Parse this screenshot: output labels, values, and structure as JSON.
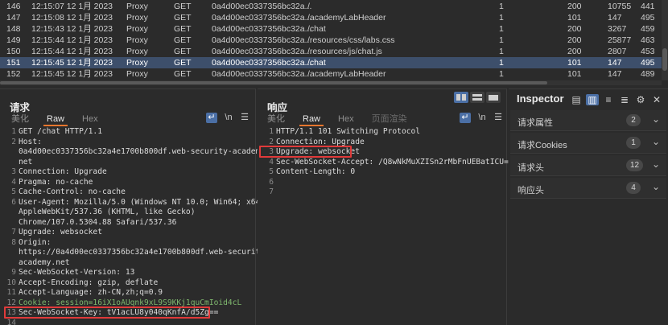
{
  "history": {
    "rows": [
      {
        "num": "146",
        "time": "12:15:07 12 1月 2023",
        "tool": "Proxy",
        "method": "GET",
        "host": "0a4d00ec0337356bc32a...",
        "path": "/",
        "flag": "1",
        "status": "200",
        "length": "10755",
        "extra": "441",
        "selected": false
      },
      {
        "num": "147",
        "time": "12:15:08 12 1月 2023",
        "tool": "Proxy",
        "method": "GET",
        "host": "0a4d00ec0337356bc32a...",
        "path": "/academyLabHeader",
        "flag": "1",
        "status": "101",
        "length": "147",
        "extra": "495",
        "selected": false
      },
      {
        "num": "148",
        "time": "12:15:43 12 1月 2023",
        "tool": "Proxy",
        "method": "GET",
        "host": "0a4d00ec0337356bc32a...",
        "path": "/chat",
        "flag": "1",
        "status": "200",
        "length": "3267",
        "extra": "459",
        "selected": false
      },
      {
        "num": "149",
        "time": "12:15:44 12 1月 2023",
        "tool": "Proxy",
        "method": "GET",
        "host": "0a4d00ec0337356bc32a...",
        "path": "/resources/css/labs.css",
        "flag": "1",
        "status": "200",
        "length": "25877",
        "extra": "463",
        "selected": false
      },
      {
        "num": "150",
        "time": "12:15:44 12 1月 2023",
        "tool": "Proxy",
        "method": "GET",
        "host": "0a4d00ec0337356bc32a...",
        "path": "/resources/js/chat.js",
        "flag": "1",
        "status": "200",
        "length": "2807",
        "extra": "453",
        "selected": false
      },
      {
        "num": "151",
        "time": "12:15:45 12 1月 2023",
        "tool": "Proxy",
        "method": "GET",
        "host": "0a4d00ec0337356bc32a...",
        "path": "/chat",
        "flag": "1",
        "status": "101",
        "length": "147",
        "extra": "495",
        "selected": true
      },
      {
        "num": "152",
        "time": "12:15:45 12 1月 2023",
        "tool": "Proxy",
        "method": "GET",
        "host": "0a4d00ec0337356bc32a...",
        "path": "/academyLabHeader",
        "flag": "1",
        "status": "101",
        "length": "147",
        "extra": "489",
        "selected": false
      }
    ]
  },
  "request": {
    "title": "请求",
    "tabs": [
      "美化",
      "Raw",
      "Hex"
    ],
    "active_tab": "Raw",
    "wrap_icon": "↵",
    "newline_label": "\\n",
    "menu_icon": "☰",
    "lines": [
      {
        "n": "1",
        "text": "GET /chat HTTP/1.1"
      },
      {
        "n": "2",
        "text": "Host:"
      },
      {
        "n": "",
        "text": "0a4d00ec0337356bc32a4e1700b800df.web-security-academy."
      },
      {
        "n": "",
        "text": "net"
      },
      {
        "n": "3",
        "text": "Connection: Upgrade"
      },
      {
        "n": "4",
        "text": "Pragma: no-cache"
      },
      {
        "n": "5",
        "text": "Cache-Control: no-cache"
      },
      {
        "n": "6",
        "text": "User-Agent: Mozilla/5.0 (Windows NT 10.0; Win64; x64)"
      },
      {
        "n": "",
        "text": "AppleWebKit/537.36 (KHTML, like Gecko)"
      },
      {
        "n": "",
        "text": "Chrome/107.0.5304.88 Safari/537.36"
      },
      {
        "n": "7",
        "text": "Upgrade: websocket"
      },
      {
        "n": "8",
        "text": "Origin:"
      },
      {
        "n": "",
        "text": "https://0a4d00ec0337356bc32a4e1700b800df.web-security-"
      },
      {
        "n": "",
        "text": "academy.net"
      },
      {
        "n": "9",
        "text": "Sec-WebSocket-Version: 13"
      },
      {
        "n": "10",
        "text": "Accept-Encoding: gzip, deflate"
      },
      {
        "n": "11",
        "text": "Accept-Language: zh-CN,zh;q=0.9"
      },
      {
        "n": "12",
        "text": "Cookie: session=16iX1oAUqnk9xL9S9KKj1quCmIoid4cL"
      },
      {
        "n": "13",
        "text": "Sec-WebSocket-Key: tV1acLU8y040qKnfA/d5Zg=="
      },
      {
        "n": "14",
        "text": ""
      }
    ]
  },
  "response": {
    "title": "响应",
    "tabs": [
      "美化",
      "Raw",
      "Hex",
      "页面渲染"
    ],
    "active_tab": "Raw",
    "wrap_icon": "↵",
    "newline_label": "\\n",
    "menu_icon": "☰",
    "lines": [
      {
        "n": "1",
        "text": "HTTP/1.1 101 Switching Protocol"
      },
      {
        "n": "2",
        "text": "Connection: Upgrade"
      },
      {
        "n": "3",
        "text": "Upgrade: websocket"
      },
      {
        "n": "4",
        "text": "Sec-WebSocket-Accept: /Q8wNkMuXZISn2rMbFnUEBatICU="
      },
      {
        "n": "5",
        "text": "Content-Length: 0"
      },
      {
        "n": "6",
        "text": ""
      },
      {
        "n": "7",
        "text": ""
      }
    ]
  },
  "inspector": {
    "title": "Inspector",
    "tool_icons": [
      "▤",
      "▥",
      "≡",
      "≣",
      "⚙",
      "✕"
    ],
    "sections": [
      {
        "label": "请求属性",
        "count": "2"
      },
      {
        "label": "请求Cookies",
        "count": "1"
      },
      {
        "label": "请求头",
        "count": "12"
      },
      {
        "label": "响应头",
        "count": "4"
      }
    ],
    "chevron": "⌄"
  },
  "colors": {
    "accent": "#e8772e",
    "selection": "#3d4f6b",
    "highlight_box": "#e03a3a",
    "toggle": "#4b6fa5"
  }
}
